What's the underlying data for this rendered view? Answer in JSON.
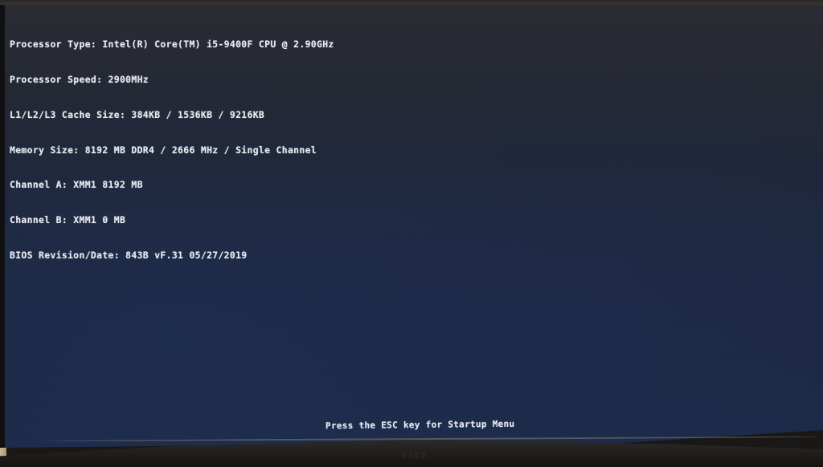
{
  "screen": {
    "type": "BIOS POST screen",
    "system_info": [
      {
        "label": "Processor Type",
        "value": "Intel(R) Core(TM) i5-9400F CPU @ 2.90GHz",
        "text": "Processor Type: Intel(R) Core(TM) i5-9400F CPU @ 2.90GHz"
      },
      {
        "label": "Processor Speed",
        "value": "2900MHz",
        "text": "Processor Speed: 2900MHz"
      },
      {
        "label": "L1/L2/L3 Cache Size",
        "value": "384KB / 1536KB / 9216KB",
        "text": "L1/L2/L3 Cache Size: 384KB / 1536KB / 9216KB"
      },
      {
        "label": "Memory Size",
        "value": "8192 MB DDR4 / 2666 MHz / Single Channel",
        "text": "Memory Size: 8192 MB DDR4 / 2666 MHz / Single Channel"
      },
      {
        "label": "Channel A",
        "value": "XMM1 8192 MB",
        "text": "Channel A: XMM1 8192 MB"
      },
      {
        "label": "Channel B",
        "value": "XMM1 0 MB",
        "text": "Channel B: XMM1 0 MB"
      },
      {
        "label": "BIOS Revision/Date",
        "value": "843B vF.31 05/27/2019",
        "text": "BIOS Revision/Date: 843B vF.31 05/27/2019"
      }
    ],
    "esc_hint": "Press the ESC key for Startup Menu",
    "startup_menu_label": "Startup Menu"
  },
  "colors": {
    "text": "#e8ecf2",
    "background": "#1d2a48"
  }
}
